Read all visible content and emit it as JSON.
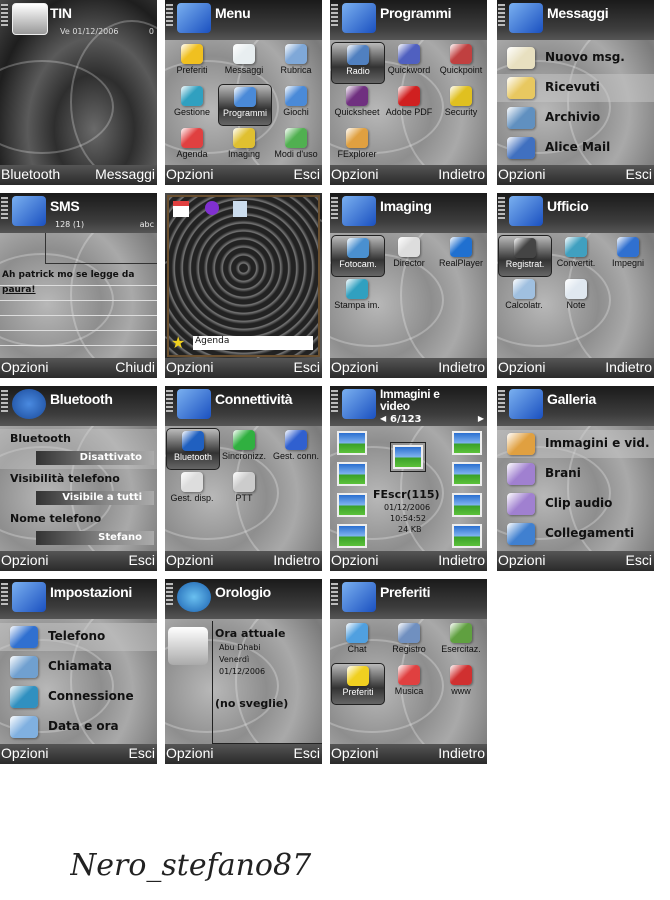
{
  "screens": [
    {
      "type": "home",
      "title": "TIN",
      "date": "Ve 01/12/2006",
      "indicator": "0",
      "left": "Bluetooth",
      "right": "Messaggi"
    },
    {
      "type": "grid",
      "title": "Menu",
      "icon": "monitor-icon",
      "selected": 4,
      "left": "Opzioni",
      "right": "Esci",
      "items": [
        {
          "label": "Preferiti",
          "icon": "folder-icon",
          "color": "#f0c020"
        },
        {
          "label": "Messaggi",
          "icon": "envelope-icon",
          "color": "#e8eef0"
        },
        {
          "label": "Rubrica",
          "icon": "contacts-book-icon",
          "color": "#7fa8d8"
        },
        {
          "label": "Gestione",
          "icon": "manager-icon",
          "color": "#30a0c0"
        },
        {
          "label": "Programmi",
          "icon": "applications-icon",
          "color": "#4a8ad8"
        },
        {
          "label": "Giochi",
          "icon": "games-icon",
          "color": "#4a8ad8"
        },
        {
          "label": "Agenda",
          "icon": "calendar-icon",
          "color": "#e04040"
        },
        {
          "label": "Imaging",
          "icon": "imaging-folder-icon",
          "color": "#e0c030"
        },
        {
          "label": "Modi d'uso",
          "icon": "profiles-icon",
          "color": "#50b050"
        }
      ]
    },
    {
      "type": "grid",
      "title": "Programmi",
      "icon": "monitor-icon",
      "selected": 0,
      "left": "Opzioni",
      "right": "Indietro",
      "items": [
        {
          "label": "Radio",
          "icon": "radio-icon",
          "color": "#5080c0"
        },
        {
          "label": "Quickword",
          "icon": "quickword-icon",
          "color": "#5060c0"
        },
        {
          "label": "Quickpoint",
          "icon": "quickpoint-icon",
          "color": "#c04040"
        },
        {
          "label": "Quicksheet",
          "icon": "quicksheet-icon",
          "color": "#703080"
        },
        {
          "label": "Adobe PDF",
          "icon": "pdf-icon",
          "color": "#d02020"
        },
        {
          "label": "Security",
          "icon": "security-icon",
          "color": "#e0c020"
        },
        {
          "label": "FExplorer",
          "icon": "fexplorer-icon",
          "color": "#e0a040"
        }
      ]
    },
    {
      "type": "list",
      "title": "Messaggi",
      "icon": "messages-icon",
      "selected": 1,
      "left": "Opzioni",
      "right": "Esci",
      "items": [
        {
          "label": "Nuovo msg.",
          "icon": "new-message-icon",
          "color": "#e8e0c0"
        },
        {
          "label": "Ricevuti",
          "icon": "inbox-folder-icon",
          "color": "#e8c860"
        },
        {
          "label": "Archivio",
          "icon": "archive-icon",
          "color": "#6090c0"
        },
        {
          "label": "Alice Mail",
          "icon": "mailbox-icon",
          "color": "#4070c0"
        }
      ]
    },
    {
      "type": "sms",
      "title": "SMS",
      "icon": "messages-icon",
      "counter": "128 (1)",
      "mode": "abc",
      "message": "Ah patrick mo se legge da",
      "message2": "paura!",
      "left": "Opzioni",
      "right": "Chiudi"
    },
    {
      "type": "idle",
      "shortcut": "Agenda",
      "left": "Opzioni",
      "right": "Esci"
    },
    {
      "type": "grid",
      "title": "Imaging",
      "icon": "monitor-icon",
      "selected": 0,
      "left": "Opzioni",
      "right": "Indietro",
      "items": [
        {
          "label": "Fotocam.",
          "icon": "camera-icon",
          "color": "#4a90d0"
        },
        {
          "label": "Director",
          "icon": "clapper-icon",
          "color": "#ddd"
        },
        {
          "label": "RealPlayer",
          "icon": "realplayer-icon",
          "color": "#2070d0"
        },
        {
          "label": "Stampa im.",
          "icon": "printer-icon",
          "color": "#30a0c0"
        }
      ]
    },
    {
      "type": "grid",
      "title": "Ufficio",
      "icon": "monitor-icon",
      "selected": 0,
      "left": "Opzioni",
      "right": "Indietro",
      "items": [
        {
          "label": "Registrat.",
          "icon": "headset-icon",
          "color": "#444"
        },
        {
          "label": "Convertit.",
          "icon": "converter-icon",
          "color": "#40a0c0"
        },
        {
          "label": "Impegni",
          "icon": "tasks-icon",
          "color": "#3070d0"
        },
        {
          "label": "Calcolatr.",
          "icon": "calculator-icon",
          "color": "#a0c0e0"
        },
        {
          "label": "Note",
          "icon": "notes-icon",
          "color": "#e0e8f0"
        }
      ]
    },
    {
      "type": "bluetooth",
      "title": "Bluetooth",
      "icon": "bluetooth-icon",
      "left": "Opzioni",
      "right": "Esci",
      "settings": [
        {
          "label": "Bluetooth",
          "value": "Disattivato"
        },
        {
          "label": "Visibilità telefono",
          "value": "Visibile a tutti"
        },
        {
          "label": "Nome telefono",
          "value": "Stefano"
        }
      ]
    },
    {
      "type": "grid",
      "title": "Connettività",
      "icon": "monitor-icon",
      "selected": 0,
      "left": "Opzioni",
      "right": "Indietro",
      "items": [
        {
          "label": "Bluetooth",
          "icon": "bluetooth-icon",
          "color": "#2060c0"
        },
        {
          "label": "Sincronizz.",
          "icon": "sync-icon",
          "color": "#30b040"
        },
        {
          "label": "Gest. conn.",
          "icon": "connection-manager-icon",
          "color": "#3060d0"
        },
        {
          "label": "Gest. disp.",
          "icon": "device-manager-icon",
          "color": "#ddd"
        },
        {
          "label": "PTT",
          "icon": "push-to-talk-icon",
          "color": "#ccc"
        }
      ]
    },
    {
      "type": "gallery",
      "title": "Immagini e",
      "title2": "video",
      "icon": "gallery-icon",
      "counter": "6/123",
      "file": "FEscr(115)",
      "date": "01/12/2006",
      "time": "10:54:52",
      "size": "24 KB",
      "left": "Opzioni",
      "right": "Indietro"
    },
    {
      "type": "list",
      "title": "Galleria",
      "icon": "gallery-icon",
      "selected": 0,
      "left": "Opzioni",
      "right": "Esci",
      "items": [
        {
          "label": "Immagini e vid.",
          "icon": "images-folder-icon",
          "color": "#e0a040"
        },
        {
          "label": "Brani",
          "icon": "music-folder-icon",
          "color": "#a080d0"
        },
        {
          "label": "Clip audio",
          "icon": "audio-clips-icon",
          "color": "#a080d0"
        },
        {
          "label": "Collegamenti",
          "icon": "links-folder-icon",
          "color": "#4080d0"
        }
      ]
    },
    {
      "type": "list",
      "title": "Impostazioni",
      "icon": "settings-icon",
      "selected": 0,
      "left": "Opzioni",
      "right": "Esci",
      "items": [
        {
          "label": "Telefono",
          "icon": "phone-settings-icon",
          "color": "#3070d0"
        },
        {
          "label": "Chiamata",
          "icon": "call-settings-icon",
          "color": "#70a0d0"
        },
        {
          "label": "Connessione",
          "icon": "connection-settings-icon",
          "color": "#3090c0"
        },
        {
          "label": "Data e ora",
          "icon": "date-time-settings-icon",
          "color": "#80b0e0"
        }
      ]
    },
    {
      "type": "clock",
      "title": "Orologio",
      "icon": "clock-icon",
      "heading": "Ora attuale",
      "city": "Abu Dhabi",
      "day": "Venerdì",
      "date": "01/12/2006",
      "alarms": "(no sveglie)",
      "left": "Opzioni",
      "right": "Esci"
    },
    {
      "type": "grid",
      "title": "Preferiti",
      "icon": "monitor-icon",
      "selected": 3,
      "left": "Opzioni",
      "right": "Indietro",
      "items": [
        {
          "label": "Chat",
          "icon": "chat-icon",
          "color": "#50a0e0"
        },
        {
          "label": "Registro",
          "icon": "log-icon",
          "color": "#7090c0"
        },
        {
          "label": "Esercitaz.",
          "icon": "tutorial-icon",
          "color": "#60a040"
        },
        {
          "label": "Preferiti",
          "icon": "star-icon",
          "color": "#f0d020"
        },
        {
          "label": "Musica",
          "icon": "music-icon",
          "color": "#e04040"
        },
        {
          "label": "www",
          "icon": "web-icon",
          "color": "#d03030"
        }
      ]
    }
  ],
  "signature": "Nero_stefano87"
}
